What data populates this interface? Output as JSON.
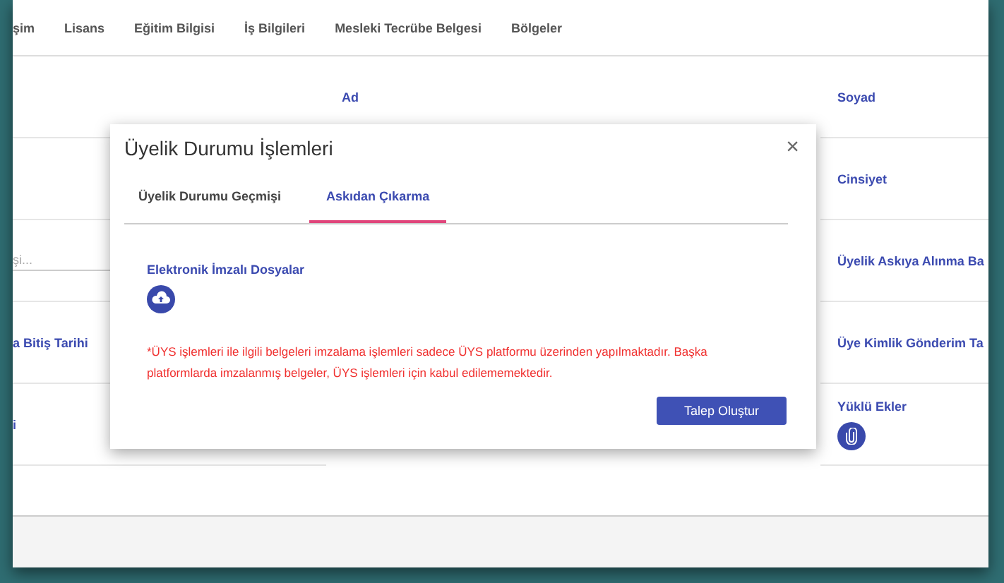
{
  "nav_tabs": [
    {
      "label": "şim"
    },
    {
      "label": "Lisans"
    },
    {
      "label": "Eğitim Bilgisi"
    },
    {
      "label": "İş Bilgileri"
    },
    {
      "label": "Mesleki Tecrübe Belgesi"
    },
    {
      "label": "Bölgeler"
    }
  ],
  "form_rows": [
    {
      "middle": "Ad",
      "right": {
        "kind": "label",
        "text": "Soyad"
      }
    },
    {
      "right": {
        "kind": "label",
        "text": "Cinsiyet"
      }
    },
    {
      "left": {
        "kind": "field",
        "placeholder": "şi..."
      },
      "right": {
        "kind": "label",
        "text": "Üyelik Askıya Alınma Ba"
      }
    },
    {
      "left": {
        "kind": "label",
        "text": "a Bitiş Tarihi"
      },
      "right": {
        "kind": "label",
        "text": "Üye Kimlik Gönderim Ta"
      }
    },
    {
      "left": {
        "kind": "label",
        "text": "i"
      },
      "right": {
        "kind": "attachment",
        "text": "Yüklü Ekler"
      }
    }
  ],
  "dialog": {
    "title": "Üyelik Durumu İşlemleri",
    "close": "×",
    "tabs": [
      {
        "label": "Üyelik Durumu Geçmişi",
        "selected": false
      },
      {
        "label": "Askıdan Çıkarma",
        "selected": true
      }
    ],
    "section_label": "Elektronik İmzalı Dosyalar",
    "warning": "*ÜYS işlemleri ile ilgili belgeleri imzalama işlemleri sadece ÜYS platformu üzerinden yapılmaktadır. Başka platformlarda imzalanmış belgeler, ÜYS işlemleri için kabul edilememektedir.",
    "button": "Talep Oluştur"
  }
}
